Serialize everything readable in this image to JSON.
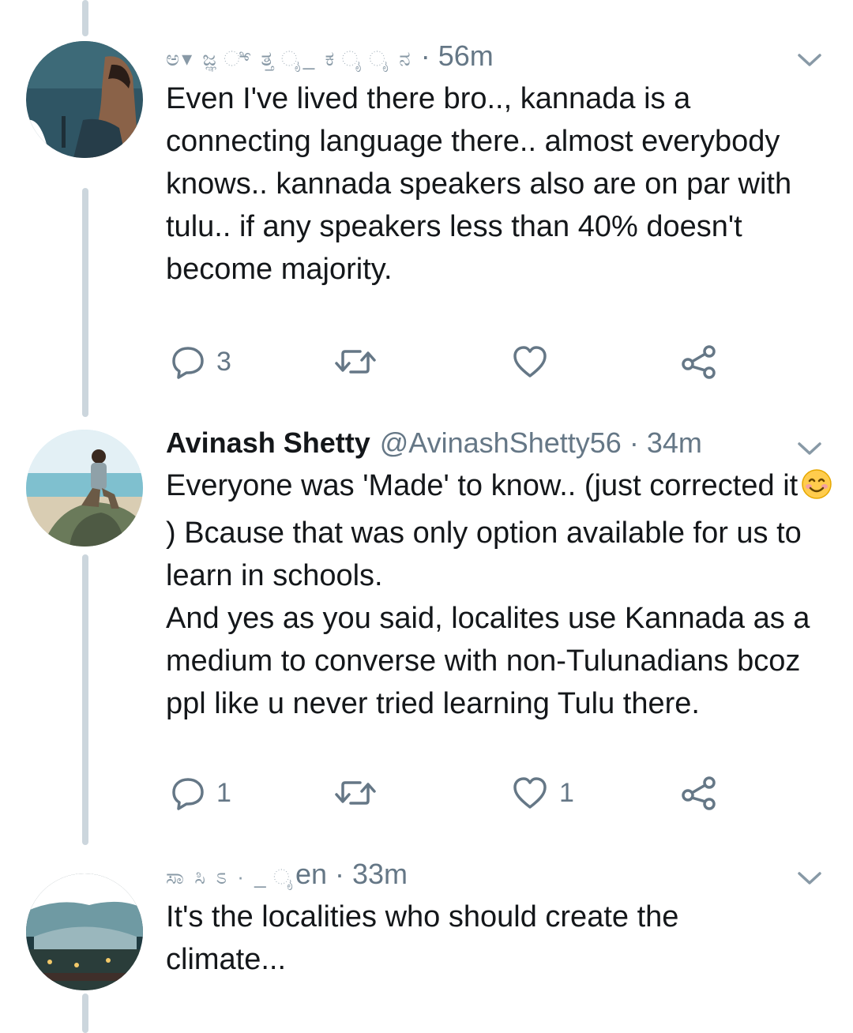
{
  "tweets": [
    {
      "name": "",
      "handle": "",
      "blurred_header": "ಅ▾ ಜ್ಞ ಿ್   ತ್ತ ೖ_ ಕ ೖ ೖ ನ",
      "time": "56m",
      "text": "Even I've lived there bro.., kannada is a connecting language there.. almost everybody knows.. kannada speakers also are on par with tulu.. if any speakers less than 40% doesn't become majority.",
      "replies": "3",
      "retweets": "",
      "likes": ""
    },
    {
      "name": "Avinash Shetty",
      "handle": "@AvinashShetty56",
      "time": "34m",
      "text_line1a": "Everyone was 'Made' to know.. (just corrected it",
      "text_line1b": ") Bcause that was only option available for us to learn in schools.",
      "text_line2": "And yes as you said, localites use Kannada as a medium to converse with non-Tulunadians bcoz ppl like u never tried learning Tulu there.",
      "emoji_name": "smiling-face-icon",
      "replies": "1",
      "retweets": "",
      "likes": "1"
    },
    {
      "name": "",
      "handle": "",
      "blurred_header": "ಸಾ ಸಿ   ಽ   ·  _ ೖ  ",
      "handle_tail": "en",
      "time": "33m",
      "text": "It's the localities who should create the climate...",
      "replies": "",
      "retweets": "",
      "likes": ""
    }
  ],
  "separator": "·",
  "icons": {
    "reply": "reply-icon",
    "retweet": "retweet-icon",
    "like": "heart-icon",
    "share": "share-icon",
    "menu": "chevron-down-icon"
  },
  "colors": {
    "text": "#14171a",
    "secondary": "#657786",
    "thread_line": "#ccd6dd"
  }
}
